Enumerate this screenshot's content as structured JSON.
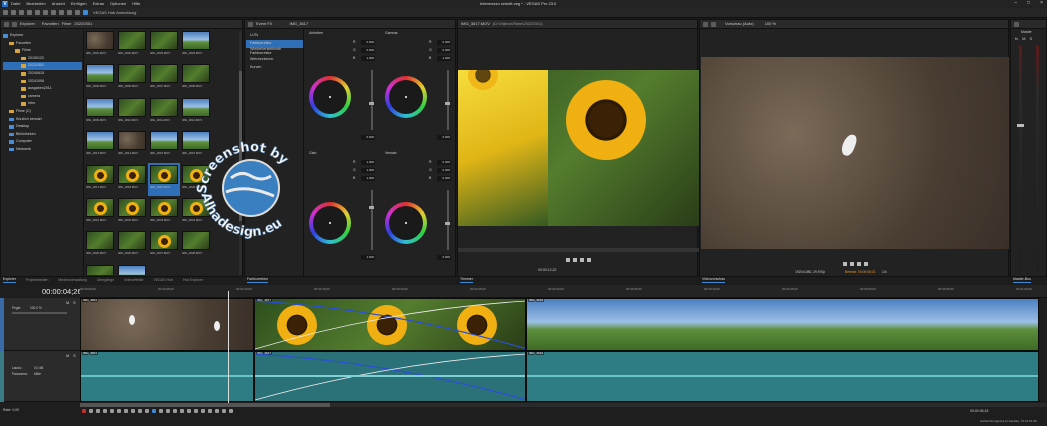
{
  "window": {
    "title": "Intermezzo schnitt.veg * - VEGAS Pro 23.0"
  },
  "menu": [
    "Datei",
    "Bearbeiten",
    "Ansicht",
    "Einfügen",
    "Extras",
    "Optionen",
    "Hilfe"
  ],
  "toolbar": {
    "hub_label": "VEGAS Hub Anmeldung"
  },
  "explorer": {
    "path_label": "Explorer",
    "crumbs": [
      "Favoriten",
      "Filme",
      "20220301"
    ],
    "tree": [
      {
        "label": "Explorer",
        "depth": 0,
        "icon": "blue"
      },
      {
        "label": "Favoriten",
        "depth": 1,
        "icon": "folder"
      },
      {
        "label": "Filme",
        "depth": 2,
        "icon": "folder"
      },
      {
        "label": "20150122",
        "depth": 3,
        "icon": "folder"
      },
      {
        "label": "20220301",
        "depth": 3,
        "icon": "folder",
        "selected": true
      },
      {
        "label": "20240615",
        "depth": 3,
        "icon": "folder"
      },
      {
        "label": "20241006",
        "depth": 3,
        "icon": "folder"
      },
      {
        "label": "ausgaben2011",
        "depth": 3,
        "icon": "folder"
      },
      {
        "label": "camera",
        "depth": 3,
        "icon": "folder"
      },
      {
        "label": "Intro",
        "depth": 3,
        "icon": "folder"
      },
      {
        "label": "Filme (C)",
        "depth": 1,
        "icon": "folder"
      },
      {
        "label": "Kürzlich benutzt",
        "depth": 1,
        "icon": "blue"
      },
      {
        "label": "Desktop",
        "depth": 1,
        "icon": "blue"
      },
      {
        "label": "Bibliotheken",
        "depth": 1,
        "icon": "blue"
      },
      {
        "label": "Computer",
        "depth": 1,
        "icon": "blue"
      },
      {
        "label": "Netzwerk",
        "depth": 1,
        "icon": "blue"
      }
    ],
    "files": [
      {
        "name": "IMG_3601.MOV",
        "t": "dirt"
      },
      {
        "name": "IMG_3602.MOV",
        "t": "leaf"
      },
      {
        "name": "IMG_3603.MOV",
        "t": "leaf"
      },
      {
        "name": "IMG_3604.MOV",
        "t": "sky"
      },
      {
        "name": "IMG_3605.MOV",
        "t": "sky"
      },
      {
        "name": "IMG_3606.MOV",
        "t": "leaf"
      },
      {
        "name": "IMG_3607.MOV",
        "t": "leaf"
      },
      {
        "name": "IMG_3608.MOV",
        "t": "leaf"
      },
      {
        "name": "IMG_3609.MOV",
        "t": "sky"
      },
      {
        "name": "IMG_3610.MOV",
        "t": "leaf"
      },
      {
        "name": "IMG_3611.MOV",
        "t": "leaf"
      },
      {
        "name": "IMG_3612.MOV",
        "t": "sky"
      },
      {
        "name": "IMG_3613.MOV",
        "t": "sky"
      },
      {
        "name": "IMG_3614.MOV",
        "t": "dirt"
      },
      {
        "name": "IMG_3615.MOV",
        "t": "sky"
      },
      {
        "name": "IMG_3616.MOV",
        "t": "sky"
      },
      {
        "name": "IMG_3617.MOV",
        "t": "sun"
      },
      {
        "name": "IMG_3618.MOV",
        "t": "sun"
      },
      {
        "name": "IMG_3619.MOV",
        "t": "sun",
        "active": true
      },
      {
        "name": "IMG_3620.MOV",
        "t": "sun"
      },
      {
        "name": "IMG_3621.MOV",
        "t": "sun"
      },
      {
        "name": "IMG_3622.MOV",
        "t": "sun"
      },
      {
        "name": "IMG_3623.MOV",
        "t": "sun"
      },
      {
        "name": "IMG_3624.MOV",
        "t": "sun"
      },
      {
        "name": "IMG_3625.MOV",
        "t": "leaf"
      },
      {
        "name": "IMG_3626.MOV",
        "t": "leaf"
      },
      {
        "name": "IMG_3627.MOV",
        "t": "sun"
      },
      {
        "name": "IMG_3628.MOV",
        "t": "leaf"
      },
      {
        "name": "IMG_3629.MOV",
        "t": "leaf"
      },
      {
        "name": "IMG_3630.MOV",
        "t": "sky"
      }
    ]
  },
  "bottom_tabs": [
    "Explorer",
    "Projektmedien",
    "Medienverwaltung",
    "Übergänge",
    "Videoeffekte",
    "VEGAS Hub",
    "Hub Explorer"
  ],
  "fx": {
    "event_label": "Event FX",
    "clip_label": "IMG_3617",
    "list": [
      "LUTs",
      "Farbkorrektur",
      "Wiederherstellende Farbkorrektur",
      "Weichzeichner",
      "Kurven"
    ],
    "selected_index": 1,
    "tab": "Farbkorrektur"
  },
  "color": {
    "wheels": [
      {
        "label": "Anheben",
        "vals": [
          "0.000",
          "0.000",
          "1.000"
        ],
        "y": "0.000"
      },
      {
        "label": "Gamma",
        "vals": [
          "0.000",
          "0.000",
          "1.000"
        ],
        "y": "0.000"
      },
      {
        "label": "Gain",
        "vals": [
          "1.000",
          "1.000",
          "1.000"
        ],
        "y": "1.000"
      },
      {
        "label": "Versatz",
        "vals": [
          "0.000",
          "0.000",
          "0.000"
        ],
        "y": "0.000"
      }
    ],
    "letters": [
      "R",
      "G",
      "B"
    ]
  },
  "trimmer": {
    "title": "IMG_3617.MOV",
    "subtitle": "(D:\\Videos\\Filme\\20220301)",
    "time": "00:00:12;22",
    "tab": "Trimmer"
  },
  "preview": {
    "mode": "Vorschau (Auto)",
    "zoom": "100 %",
    "res_label": "1920x1080, 29,970p",
    "frame_label": "Bereich: 00:00:05;01",
    "fps_label": "1/4",
    "tab": "Videovorschau"
  },
  "master": {
    "label": "Master",
    "tab": "Master-Bus",
    "letters": [
      "fx",
      "M",
      "S"
    ]
  },
  "timeline": {
    "timecode": "00:00:04;26",
    "ruler": [
      "00:00:00;00",
      "00:00:05;00",
      "00:00:10;00",
      "00:00:15;00",
      "00:00:20;00",
      "00:00:25;00",
      "00:00:30;00",
      "00:00:35;00",
      "00:00:40;00",
      "00:00:45;00",
      "00:00:50;00",
      "00:00:55;00",
      "00:01:00;00"
    ],
    "video_track": {
      "name": "Pegel:",
      "value": "100,0 %"
    },
    "audio_track": {
      "vol_label": "Lautst.:",
      "vol": "0,0 dB",
      "pan_label": "Panorama:",
      "pan": "Mitte"
    },
    "clips": {
      "v1": "IMG_3601",
      "v2": "IMG_3617",
      "v3": "IMG_3619",
      "a1": "IMG_3601",
      "a2": "IMG_3617",
      "a3": "IMG_3619"
    },
    "rate": "Rate: 0,00",
    "endtime": "00:00:06;15"
  },
  "status": {
    "text": "Aufzeichnungszeit (2 Kanäle): 70:21:51:36"
  },
  "watermark": {
    "line1": "Screenshot by",
    "line2": "Alhadesign.eu"
  }
}
